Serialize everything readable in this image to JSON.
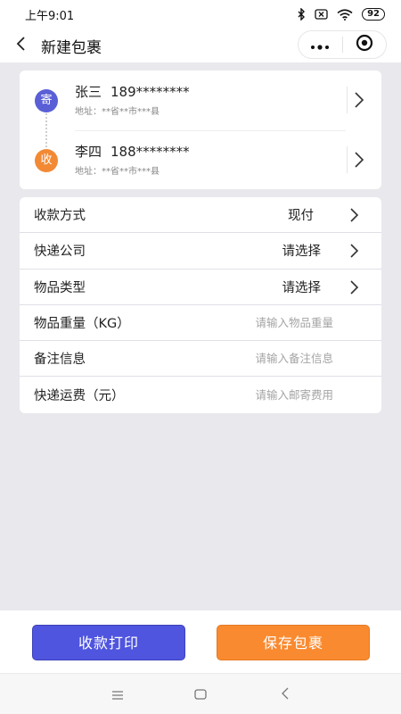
{
  "status_bar": {
    "time": "上午9:01",
    "battery": "92"
  },
  "nav": {
    "title": "新建包裹"
  },
  "sender": {
    "badge": "寄",
    "name": "张三",
    "phone": "189********",
    "address": "地址：**省**市***县"
  },
  "receiver": {
    "badge": "收",
    "name": "李四",
    "phone": "188********",
    "address": "地址：**省**市***县"
  },
  "form": {
    "payment": {
      "label": "收款方式",
      "value": "现付"
    },
    "courier": {
      "label": "快递公司",
      "value": "请选择"
    },
    "item_type": {
      "label": "物品类型",
      "value": "请选择"
    },
    "weight": {
      "label": "物品重量（KG）",
      "placeholder": "请输入物品重量"
    },
    "remark": {
      "label": "备注信息",
      "placeholder": "请输入备注信息"
    },
    "fee": {
      "label": "快递运费（元）",
      "placeholder": "请输入邮寄费用"
    }
  },
  "actions": {
    "print_label": "收款打印",
    "save_label": "保存包裹"
  },
  "colors": {
    "accent_blue": "#4f55de",
    "accent_orange": "#f98a2f",
    "send_badge": "#5a5fd6",
    "recv_badge": "#f28a35"
  },
  "icons": {
    "back": "chevron-left-icon",
    "menu": "more-dots-icon",
    "close": "target-circle-icon",
    "row_arrow": "chevron-right-icon"
  }
}
